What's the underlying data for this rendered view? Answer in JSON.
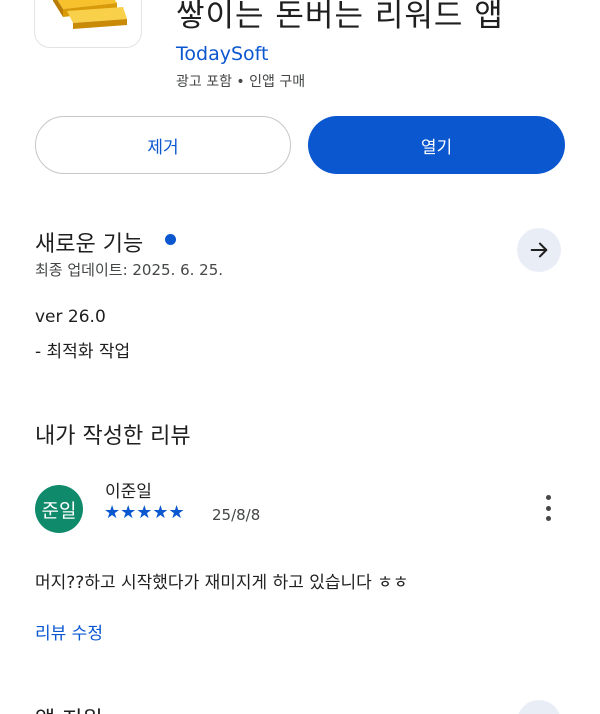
{
  "app": {
    "title": "쌓이는 돈버는 리워드 앱",
    "developer": "TodaySoft",
    "meta": "광고 포함 • 인앱 구매",
    "icon": "gold-bars-icon"
  },
  "actions": {
    "remove_label": "제거",
    "open_label": "열기"
  },
  "whats_new": {
    "title": "새로운 기능",
    "updated": "최종 업데이트: 2025. 6. 25.",
    "version": "ver 26.0",
    "note": "- 최적화 작업"
  },
  "my_review": {
    "title": "내가 작성한 리뷰",
    "avatar_text": "준일",
    "reviewer": "이준일",
    "rating": 5,
    "stars": "★★★★★",
    "date": "25/8/8",
    "text": "머지??하고 시작했다가 재미지게 하고 있습니다 ㅎㅎ",
    "edit_label": "리뷰 수정"
  },
  "next_section": {
    "title": "앱 지원"
  },
  "colors": {
    "accent": "#0b57d0",
    "avatar": "#0f8a6a",
    "arrow_bg": "#e9eef6"
  }
}
